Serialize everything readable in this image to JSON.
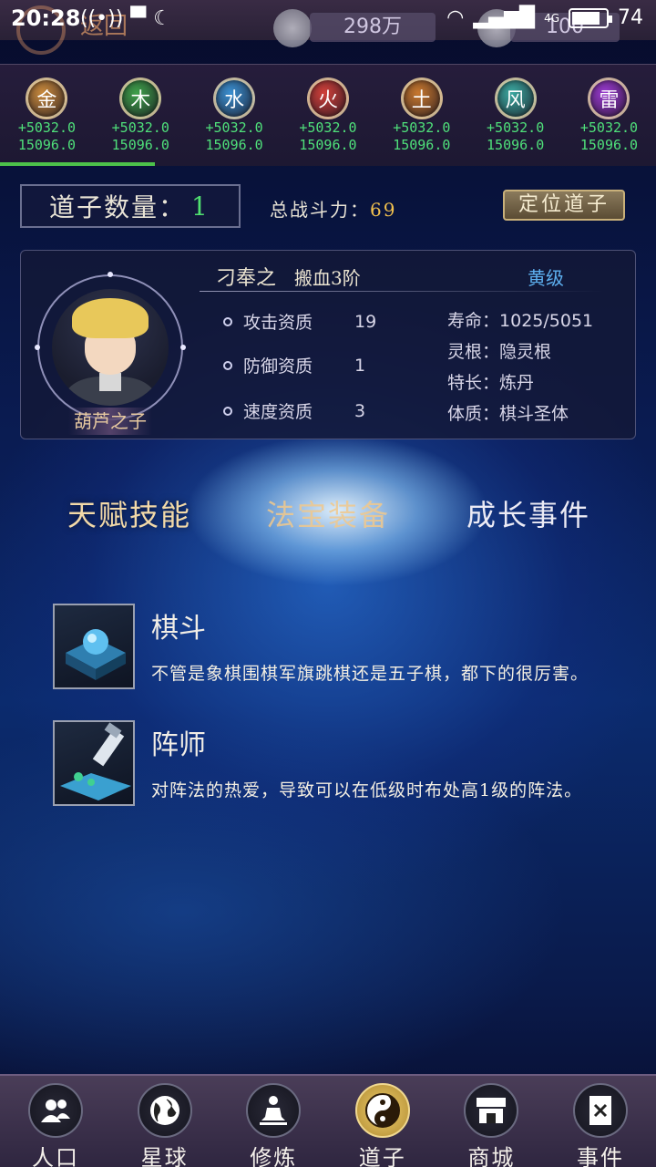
{
  "status_bar": {
    "time": "20:28",
    "network": "4G",
    "battery": "74"
  },
  "header": {
    "back_label": "返回",
    "resource1_value": "298万",
    "resource2_value": "100"
  },
  "elements": [
    {
      "name": "金",
      "color": "#c98a3c",
      "gain": "+5032.0",
      "total": "15096.0"
    },
    {
      "name": "木",
      "color": "#3ea04a",
      "gain": "+5032.0",
      "total": "15096.0"
    },
    {
      "name": "水",
      "color": "#3a8fd0",
      "gain": "+5032.0",
      "total": "15096.0"
    },
    {
      "name": "火",
      "color": "#d0403a",
      "gain": "+5032.0",
      "total": "15096.0"
    },
    {
      "name": "土",
      "color": "#c8782e",
      "gain": "+5032.0",
      "total": "15096.0"
    },
    {
      "name": "风",
      "color": "#3aa8a0",
      "gain": "+5032.0",
      "total": "15096.0"
    },
    {
      "name": "雷",
      "color": "#9a3ad0",
      "gain": "+5032.0",
      "total": "15096.0"
    }
  ],
  "disciple": {
    "count_label": "道子数量：",
    "count_value": "1",
    "power_label": "总战斗力：",
    "power_value": "69",
    "locate_button": "定位道子"
  },
  "character": {
    "tag": "葫芦之子",
    "name": "刁奉之",
    "rank": "搬血3阶",
    "grade": "黄级",
    "stats": [
      {
        "label": "攻击资质",
        "value": "19"
      },
      {
        "label": "防御资质",
        "value": "1"
      },
      {
        "label": "速度资质",
        "value": "3"
      }
    ],
    "info": [
      {
        "label": "寿命：",
        "value": "1025/5051"
      },
      {
        "label": "灵根：",
        "value": "隐灵根"
      },
      {
        "label": "特长：",
        "value": "炼丹"
      },
      {
        "label": "体质：",
        "value": "棋斗圣体"
      }
    ]
  },
  "tabs": [
    "天赋技能",
    "法宝装备",
    "成长事件"
  ],
  "skills": [
    {
      "name": "棋斗",
      "desc": "不管是象棋围棋军旗跳棋还是五子棋，都下的很厉害。"
    },
    {
      "name": "阵师",
      "desc": "对阵法的热爱，导致可以在低级时布处高1级的阵法。"
    }
  ],
  "bottom_nav": [
    {
      "label": "人口",
      "icon": "people-icon"
    },
    {
      "label": "星球",
      "icon": "globe-icon"
    },
    {
      "label": "修炼",
      "icon": "meditate-icon"
    },
    {
      "label": "道子",
      "icon": "yinyang-icon"
    },
    {
      "label": "商城",
      "icon": "shop-icon"
    },
    {
      "label": "事件",
      "icon": "book-icon"
    }
  ]
}
